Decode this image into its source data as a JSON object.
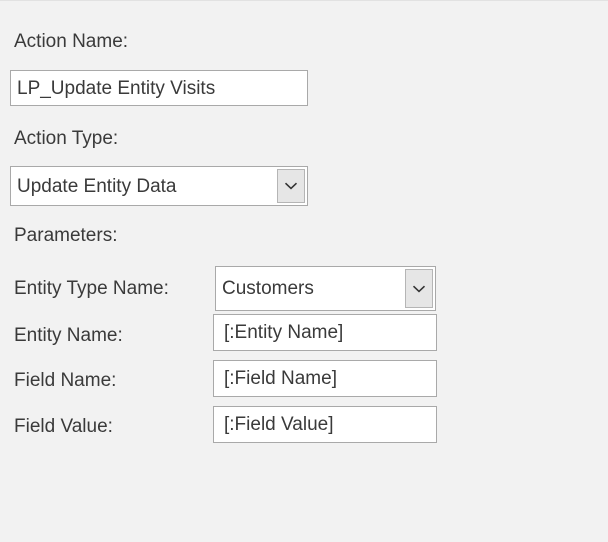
{
  "form": {
    "action_name": {
      "label": "Action Name:",
      "value": "LP_Update Entity Visits"
    },
    "action_type": {
      "label": "Action Type:",
      "value": "Update Entity Data",
      "dropdown_icon": "chevron-down-icon"
    },
    "parameters": {
      "label": "Parameters:",
      "rows": [
        {
          "label": "Entity Type Name:",
          "value": "Customers",
          "control": "combobox",
          "dropdown_icon": "chevron-down-icon"
        },
        {
          "label": "Entity Name:",
          "value": "[:Entity Name]",
          "control": "textbox"
        },
        {
          "label": "Field Name:",
          "value": "[:Field Name]",
          "control": "textbox"
        },
        {
          "label": "Field Value:",
          "value": "[:Field Value]",
          "control": "textbox"
        }
      ]
    }
  },
  "colors": {
    "background": "#f2f2f2",
    "field_background": "#ffffff",
    "field_border": "#a9a9a9",
    "text": "#3a3a3a",
    "button_face": "#e6e6e6"
  }
}
